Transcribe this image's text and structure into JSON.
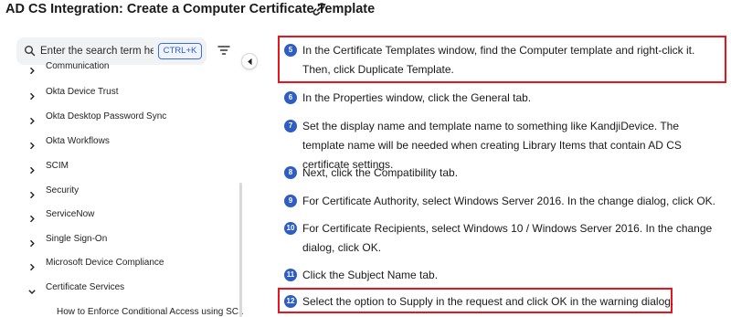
{
  "header": {
    "title": "AD CS Integration: Create a Computer Certificate Template",
    "link_icon": "link-icon"
  },
  "sidebar": {
    "search": {
      "placeholder": "Enter the search term here",
      "shortcut": "CTRL+K"
    },
    "items": [
      {
        "label": "Communication",
        "expanded": false
      },
      {
        "label": "Okta Device Trust",
        "expanded": false
      },
      {
        "label": "Okta Desktop Password Sync",
        "expanded": false
      },
      {
        "label": "Okta Workflows",
        "expanded": false
      },
      {
        "label": "SCIM",
        "expanded": false
      },
      {
        "label": "Security",
        "expanded": false
      },
      {
        "label": "ServiceNow",
        "expanded": false
      },
      {
        "label": "Single Sign-On",
        "expanded": false
      },
      {
        "label": "Microsoft Device Compliance",
        "expanded": false
      },
      {
        "label": "Certificate Services",
        "expanded": true
      }
    ],
    "sub_items": [
      {
        "label": "How to Enforce Conditional Access using SC..."
      }
    ]
  },
  "steps": [
    {
      "number": "5",
      "text": "In the Certificate Templates window, find the Computer template and right-click it. Then, click Duplicate Template.",
      "highlighted": true
    },
    {
      "number": "6",
      "text": "In the Properties window, click the General tab.",
      "highlighted": false
    },
    {
      "number": "7",
      "text": "Set the display name and template name to something like KandjiDevice. The template name will be needed when creating Library Items that contain AD CS certificate settings.",
      "highlighted": false
    },
    {
      "number": "8",
      "text": "Next, click the Compatibility tab.",
      "highlighted": false
    },
    {
      "number": "9",
      "text": "For Certificate Authority, select Windows Server 2016. In the change dialog, click OK.",
      "highlighted": false
    },
    {
      "number": "10",
      "text": "For Certificate Recipients, select Windows 10 / Windows Server 2016. In the change dialog, click OK.",
      "highlighted": false
    },
    {
      "number": "11",
      "text": "Click the Subject Name tab.",
      "highlighted": false
    },
    {
      "number": "12",
      "text": "Select the option to Supply in the request and click OK in the warning dialog.",
      "highlighted": true
    }
  ],
  "colors": {
    "accent": "#2e5ec4",
    "highlight": "#e8141e",
    "search_bg": "#f1f2f4"
  }
}
